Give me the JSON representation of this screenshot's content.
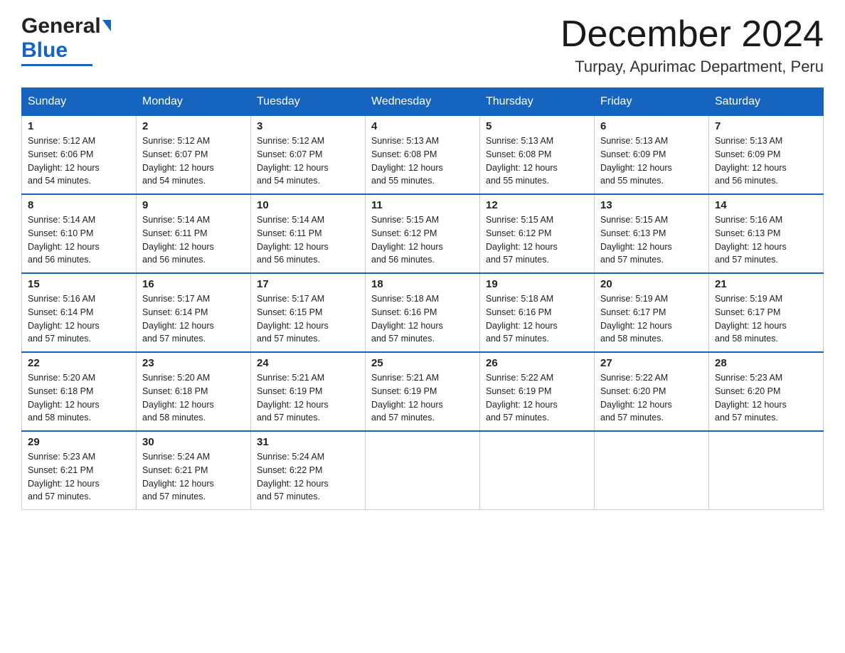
{
  "header": {
    "logo_general": "General",
    "logo_blue": "Blue",
    "month_title": "December 2024",
    "location": "Turpay, Apurimac Department, Peru"
  },
  "days_of_week": [
    "Sunday",
    "Monday",
    "Tuesday",
    "Wednesday",
    "Thursday",
    "Friday",
    "Saturday"
  ],
  "weeks": [
    [
      {
        "day": "1",
        "sunrise": "5:12 AM",
        "sunset": "6:06 PM",
        "daylight": "12 hours and 54 minutes."
      },
      {
        "day": "2",
        "sunrise": "5:12 AM",
        "sunset": "6:07 PM",
        "daylight": "12 hours and 54 minutes."
      },
      {
        "day": "3",
        "sunrise": "5:12 AM",
        "sunset": "6:07 PM",
        "daylight": "12 hours and 54 minutes."
      },
      {
        "day": "4",
        "sunrise": "5:13 AM",
        "sunset": "6:08 PM",
        "daylight": "12 hours and 55 minutes."
      },
      {
        "day": "5",
        "sunrise": "5:13 AM",
        "sunset": "6:08 PM",
        "daylight": "12 hours and 55 minutes."
      },
      {
        "day": "6",
        "sunrise": "5:13 AM",
        "sunset": "6:09 PM",
        "daylight": "12 hours and 55 minutes."
      },
      {
        "day": "7",
        "sunrise": "5:13 AM",
        "sunset": "6:09 PM",
        "daylight": "12 hours and 56 minutes."
      }
    ],
    [
      {
        "day": "8",
        "sunrise": "5:14 AM",
        "sunset": "6:10 PM",
        "daylight": "12 hours and 56 minutes."
      },
      {
        "day": "9",
        "sunrise": "5:14 AM",
        "sunset": "6:11 PM",
        "daylight": "12 hours and 56 minutes."
      },
      {
        "day": "10",
        "sunrise": "5:14 AM",
        "sunset": "6:11 PM",
        "daylight": "12 hours and 56 minutes."
      },
      {
        "day": "11",
        "sunrise": "5:15 AM",
        "sunset": "6:12 PM",
        "daylight": "12 hours and 56 minutes."
      },
      {
        "day": "12",
        "sunrise": "5:15 AM",
        "sunset": "6:12 PM",
        "daylight": "12 hours and 57 minutes."
      },
      {
        "day": "13",
        "sunrise": "5:15 AM",
        "sunset": "6:13 PM",
        "daylight": "12 hours and 57 minutes."
      },
      {
        "day": "14",
        "sunrise": "5:16 AM",
        "sunset": "6:13 PM",
        "daylight": "12 hours and 57 minutes."
      }
    ],
    [
      {
        "day": "15",
        "sunrise": "5:16 AM",
        "sunset": "6:14 PM",
        "daylight": "12 hours and 57 minutes."
      },
      {
        "day": "16",
        "sunrise": "5:17 AM",
        "sunset": "6:14 PM",
        "daylight": "12 hours and 57 minutes."
      },
      {
        "day": "17",
        "sunrise": "5:17 AM",
        "sunset": "6:15 PM",
        "daylight": "12 hours and 57 minutes."
      },
      {
        "day": "18",
        "sunrise": "5:18 AM",
        "sunset": "6:16 PM",
        "daylight": "12 hours and 57 minutes."
      },
      {
        "day": "19",
        "sunrise": "5:18 AM",
        "sunset": "6:16 PM",
        "daylight": "12 hours and 57 minutes."
      },
      {
        "day": "20",
        "sunrise": "5:19 AM",
        "sunset": "6:17 PM",
        "daylight": "12 hours and 58 minutes."
      },
      {
        "day": "21",
        "sunrise": "5:19 AM",
        "sunset": "6:17 PM",
        "daylight": "12 hours and 58 minutes."
      }
    ],
    [
      {
        "day": "22",
        "sunrise": "5:20 AM",
        "sunset": "6:18 PM",
        "daylight": "12 hours and 58 minutes."
      },
      {
        "day": "23",
        "sunrise": "5:20 AM",
        "sunset": "6:18 PM",
        "daylight": "12 hours and 58 minutes."
      },
      {
        "day": "24",
        "sunrise": "5:21 AM",
        "sunset": "6:19 PM",
        "daylight": "12 hours and 57 minutes."
      },
      {
        "day": "25",
        "sunrise": "5:21 AM",
        "sunset": "6:19 PM",
        "daylight": "12 hours and 57 minutes."
      },
      {
        "day": "26",
        "sunrise": "5:22 AM",
        "sunset": "6:19 PM",
        "daylight": "12 hours and 57 minutes."
      },
      {
        "day": "27",
        "sunrise": "5:22 AM",
        "sunset": "6:20 PM",
        "daylight": "12 hours and 57 minutes."
      },
      {
        "day": "28",
        "sunrise": "5:23 AM",
        "sunset": "6:20 PM",
        "daylight": "12 hours and 57 minutes."
      }
    ],
    [
      {
        "day": "29",
        "sunrise": "5:23 AM",
        "sunset": "6:21 PM",
        "daylight": "12 hours and 57 minutes."
      },
      {
        "day": "30",
        "sunrise": "5:24 AM",
        "sunset": "6:21 PM",
        "daylight": "12 hours and 57 minutes."
      },
      {
        "day": "31",
        "sunrise": "5:24 AM",
        "sunset": "6:22 PM",
        "daylight": "12 hours and 57 minutes."
      },
      null,
      null,
      null,
      null
    ]
  ],
  "labels": {
    "sunrise": "Sunrise:",
    "sunset": "Sunset:",
    "daylight": "Daylight:"
  },
  "colors": {
    "header_bg": "#1565c0",
    "header_text": "#ffffff",
    "border_accent": "#1565c0",
    "text_primary": "#222222"
  }
}
